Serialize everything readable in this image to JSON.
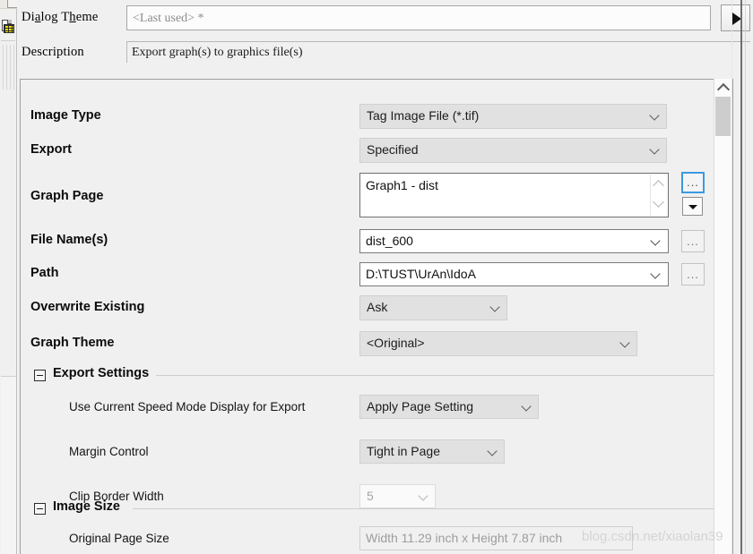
{
  "header": {
    "theme_label_a": "Di",
    "theme_label_mn1": "a",
    "theme_label_b": "log T",
    "theme_label_mn2": "h",
    "theme_label_c": "eme",
    "theme_label": "Dialog Theme",
    "theme_value": "<Last used> *",
    "theme_arrow_icon": "play-triangle-icon",
    "description_label": "Description",
    "description_value": "Export graph(s) to graphics file(s)"
  },
  "form": {
    "image_type": {
      "label": "Image Type",
      "value": "Tag Image File (*.tif)"
    },
    "export": {
      "label": "Export",
      "value": "Specified"
    },
    "graph_page": {
      "label": "Graph Page",
      "value": "Graph1 - dist",
      "browse_label": "...",
      "dropdown_icon": "caret-down-icon",
      "spin_up_icon": "chevron-up-icon",
      "spin_down_icon": "chevron-down-icon"
    },
    "file_names": {
      "label": "File Name(s)",
      "value": "dist_600",
      "browse_label": "..."
    },
    "path": {
      "label": "Path",
      "value": "D:\\TUST\\UrAn\\IdoA",
      "browse_label": "..."
    },
    "overwrite_existing": {
      "label": "Overwrite Existing",
      "value": "Ask"
    },
    "graph_theme": {
      "label": "Graph Theme",
      "value": "<Original>"
    }
  },
  "export_settings": {
    "group_title": "Export Settings",
    "collapse_icon": "minus-box-icon",
    "speed_mode": {
      "label": "Use Current Speed Mode Display for Export",
      "value": "Apply Page Setting"
    },
    "margin_control": {
      "label": "Margin Control",
      "value": "Tight in Page"
    },
    "clip_border_width": {
      "label": "Clip Border Width",
      "value": "5"
    }
  },
  "image_size": {
    "group_title": "Image Size",
    "collapse_icon": "minus-box-icon",
    "original_page_size": {
      "label": "Original Page Size",
      "value": "Width 11.29 inch x Height 7.87 inch"
    }
  },
  "scrollbar": {
    "up_arrow_icon": "chevron-up-icon"
  },
  "sidebar": {
    "worksheet_icon": "worksheet-grid-icon"
  },
  "watermark": {
    "text": "blog.csdn.net/xiaolan39"
  }
}
